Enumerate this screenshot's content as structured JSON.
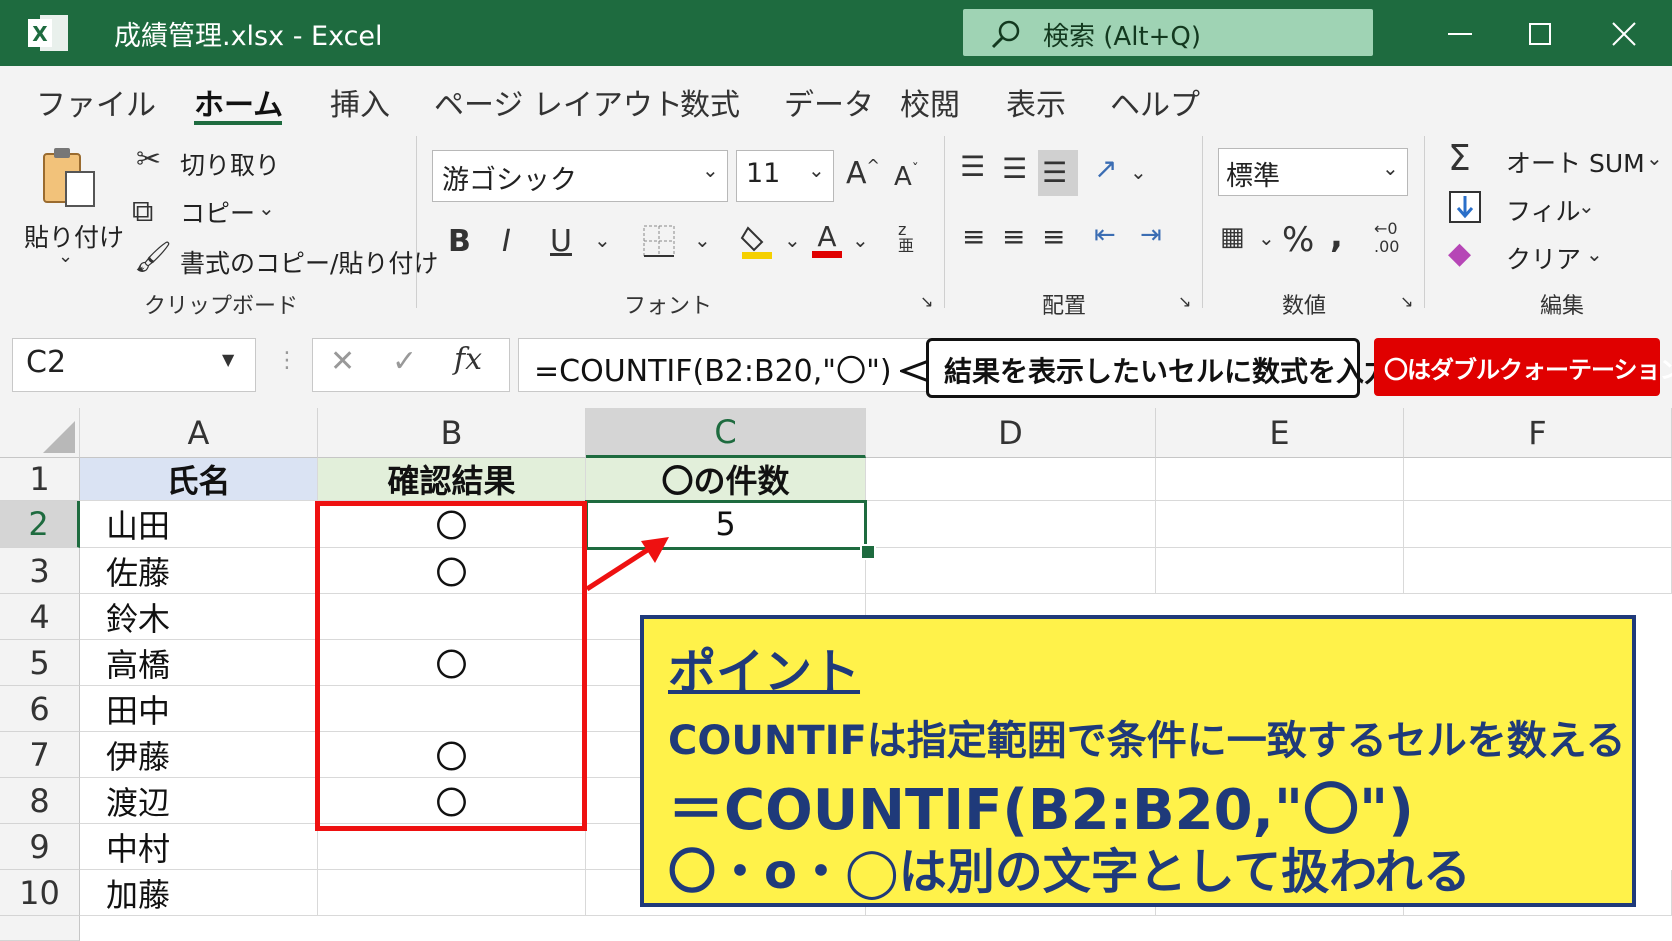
{
  "window": {
    "title": "成績管理.xlsx  -  Excel",
    "search_placeholder": "検索 (Alt+Q)",
    "accent_color": "#1e6b3f"
  },
  "ribbon": {
    "tabs": [
      "ファイル",
      "ホーム",
      "挿入",
      "ページ レイアウト",
      "数式",
      "データ",
      "校閲",
      "表示",
      "ヘルプ"
    ],
    "active_tab": "ホーム",
    "clipboard": {
      "paste_label": "貼り付け",
      "cut_label": "切り取り",
      "copy_label": "コピー",
      "format_painter_label": "書式のコピー/貼り付け",
      "group_label": "クリップボード"
    },
    "font": {
      "font_name": "游ゴシック",
      "font_size": "11",
      "group_label": "フォント"
    },
    "alignment": {
      "group_label": "配置"
    },
    "number": {
      "format": "標準",
      "group_label": "数値"
    },
    "editing": {
      "autosum_label": "オート SUM",
      "fill_label": "フィル",
      "clear_label": "クリア",
      "group_label": "編集"
    }
  },
  "formula_bar": {
    "name_box": "C2",
    "formula": "=COUNTIF(B2:B20,\"〇\")"
  },
  "annotations": {
    "callout": "結果を表示したいセルに数式を入力",
    "red_note": "〇はダブルクォーテーションで囲む",
    "point_title": "ポイント",
    "point_line1": "COUNTIFは指定範囲で条件に一致するセルを数える",
    "point_line2": "＝COUNTIF(B2:B20,\"〇\")",
    "point_line3": "〇・o・◯は別の文字として扱われる"
  },
  "sheet": {
    "columns": [
      "A",
      "B",
      "C",
      "D",
      "E",
      "F"
    ],
    "rows": [
      "1",
      "2",
      "3",
      "4",
      "5",
      "6",
      "7",
      "8",
      "9",
      "10"
    ],
    "headers": {
      "a": "氏名",
      "b": "確認結果",
      "c": "〇の件数"
    },
    "names": [
      "山田",
      "佐藤",
      "鈴木",
      "高橋",
      "田中",
      "伊藤",
      "渡辺",
      "中村",
      "加藤"
    ],
    "results": [
      "〇",
      "〇",
      "",
      "〇",
      "",
      "〇",
      "〇"
    ],
    "count_value": "5",
    "header_colors": {
      "a": "#dae3f3",
      "b": "#e2efda",
      "c": "#e2efda"
    }
  }
}
